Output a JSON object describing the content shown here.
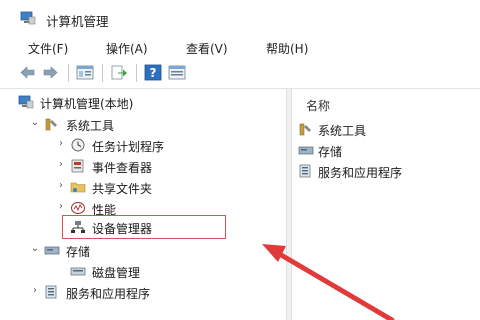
{
  "window": {
    "title": "计算机管理"
  },
  "menu": [
    "文件(F)",
    "操作(A)",
    "查看(V)",
    "帮助(H)"
  ],
  "toolbar": [
    "back-icon",
    "forward-icon",
    "show-hide-tree-icon",
    "export-icon",
    "help-icon",
    "properties-icon"
  ],
  "tree": {
    "root": "计算机管理(本地)",
    "system_tools": "系统工具",
    "task_scheduler": "任务计划程序",
    "event_viewer": "事件查看器",
    "shared_folders": "共享文件夹",
    "performance": "性能",
    "device_manager": "设备管理器",
    "storage": "存储",
    "disk_management": "磁盘管理",
    "services_apps": "服务和应用程序"
  },
  "right_pane": {
    "header": "名称",
    "items": [
      "系统工具",
      "存储",
      "服务和应用程序"
    ]
  },
  "colors": {
    "highlight": "#d9534f",
    "arrow": "#e03a3a"
  }
}
